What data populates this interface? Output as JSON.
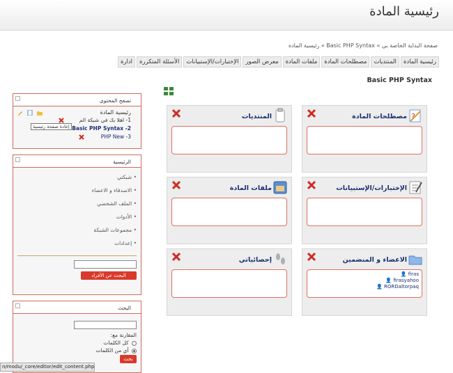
{
  "page": {
    "title": "رئيسية المادة"
  },
  "breadcrumb": "صفحة البداية الخاصة بي » Basic PHP Syntax » رئيسية المادة",
  "tabs": [
    "رئيسية المادة",
    "المنتديات",
    "مصطلحات المادة",
    "ملفات المادة",
    "معرض الصور",
    "الإختبارات/الإستبيانات",
    "الأسئلة المتكررة",
    "ادارة"
  ],
  "course": {
    "name": "Basic PHP Syntax"
  },
  "panels": {
    "glossary": {
      "title": "مصطلحات المادة",
      "icon": "glossary-icon"
    },
    "forums": {
      "title": "المنتديات",
      "icon": "forums-icon"
    },
    "quizzes": {
      "title": "الإختبارات/الإستبيانات",
      "icon": "quiz-icon"
    },
    "files": {
      "title": "ملفات المادة",
      "icon": "files-icon"
    },
    "members": {
      "title": "الاعضاء و المنضمين",
      "icon": "members-icon",
      "users": [
        "firas",
        "firasyahoo",
        "RORDaltorpaq"
      ]
    },
    "stats": {
      "title": "إحصائياتي",
      "icon": "footprints-icon"
    }
  },
  "sidebar": {
    "browse": {
      "title": "تصفح المحتوى",
      "root": "رئيسية المادة",
      "item1": "1- اهلا بك في شبكة الم",
      "tooltip": "إعادة صفحة رئيسية",
      "item2": "Basic PHP Syntax -2",
      "item3": "PHP New -3"
    },
    "main": {
      "title": "الرئيسية",
      "items": [
        "شبكتي",
        "الاصدقاء و الاعضاء",
        "الملف الشخصي",
        "الأدوات",
        "مجموعات الشبكة",
        "إعدادات"
      ],
      "search_button": "البحث عن الأفراد"
    },
    "search": {
      "title": "البحث",
      "match_label": "المقارنة مع:",
      "option_all": "كل الكلمات",
      "option_any": "أي من الكلمات",
      "button": "بحث"
    }
  },
  "status_url": "n/modu/_core/editor/edit_content.php"
}
